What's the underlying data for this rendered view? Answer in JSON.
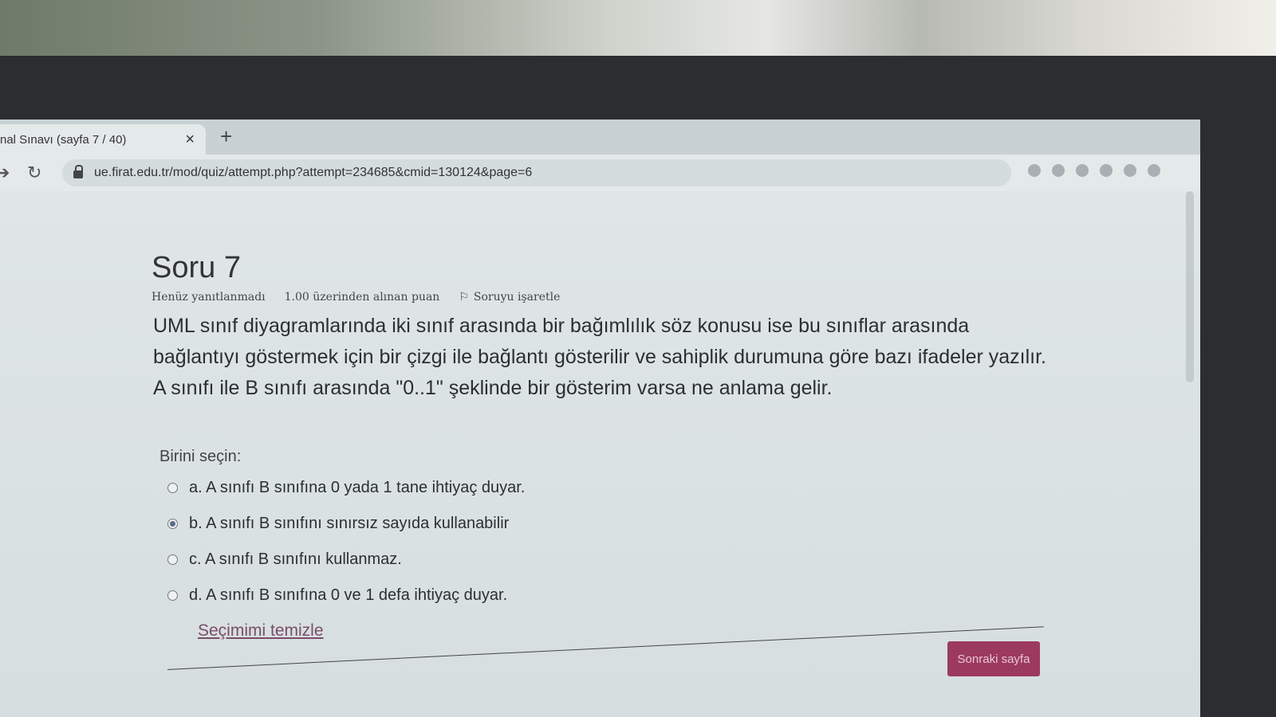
{
  "browser": {
    "tab_title": "nal Sınavı (sayfa 7 / 40)",
    "close_glyph": "×",
    "newtab_glyph": "+",
    "url": "ue.firat.edu.tr/mod/quiz/attempt.php?attempt=234685&cmid=130124&page=6"
  },
  "question": {
    "title": "Soru 7",
    "status": "Henüz yanıtlanmadı",
    "points": "1.00 üzerinden alınan puan",
    "flag_label": "Soruyu işaretle",
    "text": "UML sınıf diyagramlarında iki sınıf arasında bir bağımlılık söz konusu ise bu sınıflar arasında bağlantıyı göstermek için bir çizgi ile bağlantı gösterilir ve sahiplik durumuna göre bazı ifadeler yazılır. A sınıfı ile B sınıfı arasında \"0..1\" şeklinde bir gösterim varsa ne anlama gelir.",
    "choose_label": "Birini seçin:",
    "answers": [
      {
        "label": "a. A sınıfı B sınıfına 0 yada 1 tane ihtiyaç duyar.",
        "selected": false
      },
      {
        "label": "b. A sınıfı B sınıfını sınırsız sayıda kullanabilir",
        "selected": true
      },
      {
        "label": "c. A sınıfı B sınıfını kullanmaz.",
        "selected": false
      },
      {
        "label": "d. A sınıfı B sınıfına 0 ve 1 defa ihtiyaç duyar.",
        "selected": false
      }
    ],
    "clear_label": "Seçimimi temizle",
    "next_label": "Sonraki sayfa"
  }
}
